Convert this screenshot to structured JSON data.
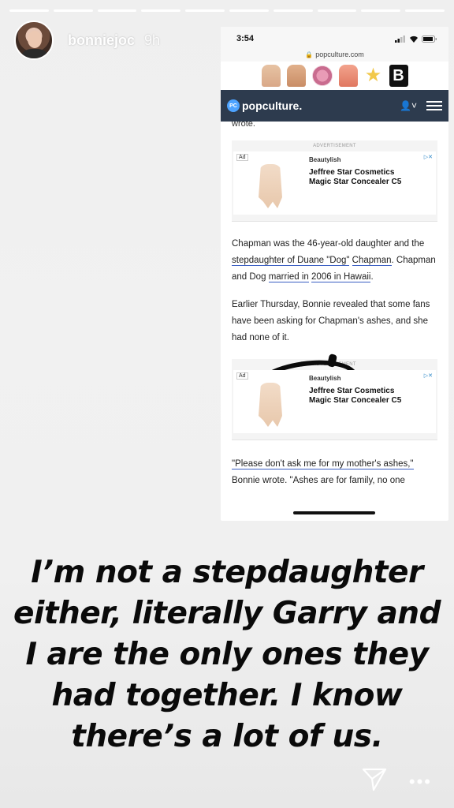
{
  "story": {
    "username": "bonniejoc",
    "time_ago": "9h",
    "segments": 10
  },
  "embedded_screenshot": {
    "status_time": "3:54",
    "url": "popculture.com",
    "site_name": "popculture.",
    "logo_badge": "PC",
    "cut_text": "wrote.",
    "ad1": {
      "advertisement_label": "ADVERTISEMENT",
      "ad_tag": "Ad",
      "brand": "Beautylish",
      "title_line1": "Jeffree Star Cosmetics",
      "title_line2": "Magic Star Concealer C5"
    },
    "para1": {
      "t1": "Chapman was the 46-year-old daughter",
      "t2": "and the ",
      "link1": "stepdaughter of Duane \"Dog\"",
      "t3": "Chapman",
      "t4": ". Chapman and Dog ",
      "link2": "married in",
      "link3": "2006 in Hawaii",
      "t5": "."
    },
    "para2": "Earlier Thursday, Bonnie revealed that some fans have been asking for Chapman's ashes, and she had none of it.",
    "ad2": {
      "advertisement_label": "ADVERTISEMENT",
      "ad_tag": "Ad",
      "brand": "Beautylish",
      "title_line1": "Jeffree Star Cosmetics",
      "title_line2": "Magic Star Concealer C5"
    },
    "para3": "\"Please don't ask me for my mother's ashes,\"",
    "para4": "Bonnie wrote. \"Ashes are for family, no one"
  },
  "caption": {
    "line1": "I’m not a stepdaughter",
    "line2": "either, literally Garry and",
    "line3": "I are the only ones they",
    "line4": "had together. I know",
    "line5": "there’s a lot of us."
  },
  "icons": {
    "close": "close-icon",
    "share": "send-icon",
    "more": "more-icon"
  }
}
